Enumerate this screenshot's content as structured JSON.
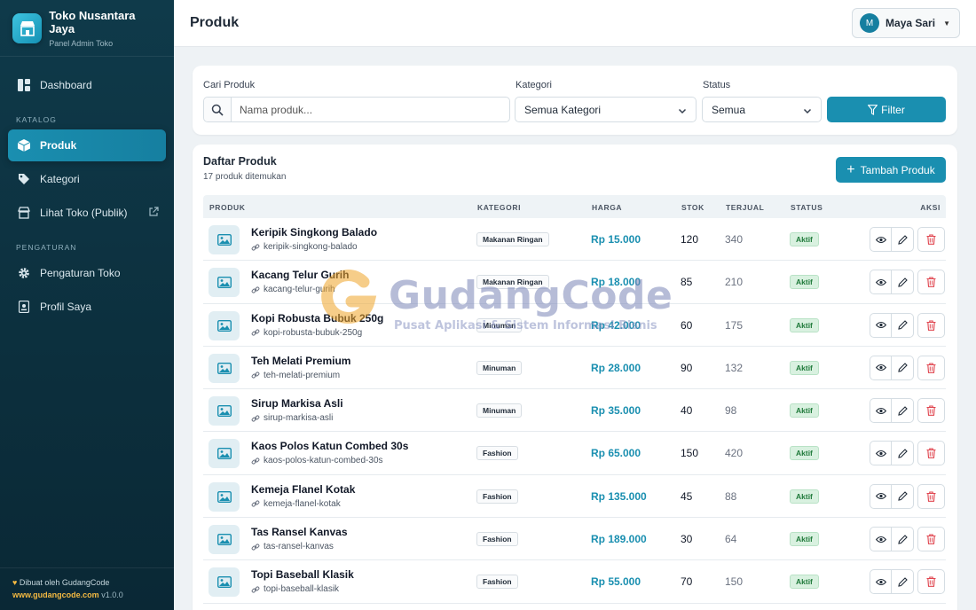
{
  "brand": {
    "name": "Toko Nusantara Jaya",
    "subtitle": "Panel Admin Toko"
  },
  "nav": {
    "dashboard": "Dashboard",
    "section_katalog": "KATALOG",
    "produk": "Produk",
    "kategori": "Kategori",
    "lihat_toko": "Lihat Toko (Publik)",
    "section_pengaturan": "PENGATURAN",
    "pengaturan_toko": "Pengaturan Toko",
    "profil_saya": "Profil Saya"
  },
  "footer": {
    "credit": "Dibuat oleh GudangCode",
    "site": "www.gudangcode.com",
    "version": "v1.0.0"
  },
  "header": {
    "title": "Produk",
    "user_initial": "M",
    "user_name": "Maya Sari"
  },
  "filter": {
    "search_label": "Cari Produk",
    "search_placeholder": "Nama produk...",
    "category_label": "Kategori",
    "category_value": "Semua Kategori",
    "status_label": "Status",
    "status_value": "Semua",
    "button": "Filter"
  },
  "list": {
    "title": "Daftar Produk",
    "count_text": "17 produk ditemukan",
    "add_button": "Tambah Produk",
    "columns": {
      "produk": "PRODUK",
      "kategori": "KATEGORI",
      "harga": "HARGA",
      "stok": "STOK",
      "terjual": "TERJUAL",
      "status": "STATUS",
      "aksi": "AKSI"
    },
    "rows": [
      {
        "name": "Keripik Singkong Balado",
        "slug": "keripik-singkong-balado",
        "category": "Makanan Ringan",
        "price": "Rp 15.000",
        "stock": "120",
        "sold": "340",
        "status": "Aktif"
      },
      {
        "name": "Kacang Telur Gurih",
        "slug": "kacang-telur-gurih",
        "category": "Makanan Ringan",
        "price": "Rp 18.000",
        "stock": "85",
        "sold": "210",
        "status": "Aktif"
      },
      {
        "name": "Kopi Robusta Bubuk 250g",
        "slug": "kopi-robusta-bubuk-250g",
        "category": "Minuman",
        "price": "Rp 42.000",
        "stock": "60",
        "sold": "175",
        "status": "Aktif"
      },
      {
        "name": "Teh Melati Premium",
        "slug": "teh-melati-premium",
        "category": "Minuman",
        "price": "Rp 28.000",
        "stock": "90",
        "sold": "132",
        "status": "Aktif"
      },
      {
        "name": "Sirup Markisa Asli",
        "slug": "sirup-markisa-asli",
        "category": "Minuman",
        "price": "Rp 35.000",
        "stock": "40",
        "sold": "98",
        "status": "Aktif"
      },
      {
        "name": "Kaos Polos Katun Combed 30s",
        "slug": "kaos-polos-katun-combed-30s",
        "category": "Fashion",
        "price": "Rp 65.000",
        "stock": "150",
        "sold": "420",
        "status": "Aktif"
      },
      {
        "name": "Kemeja Flanel Kotak",
        "slug": "kemeja-flanel-kotak",
        "category": "Fashion",
        "price": "Rp 135.000",
        "stock": "45",
        "sold": "88",
        "status": "Aktif"
      },
      {
        "name": "Tas Ransel Kanvas",
        "slug": "tas-ransel-kanvas",
        "category": "Fashion",
        "price": "Rp 189.000",
        "stock": "30",
        "sold": "64",
        "status": "Aktif"
      },
      {
        "name": "Topi Baseball Klasik",
        "slug": "topi-baseball-klasik",
        "category": "Fashion",
        "price": "Rp 55.000",
        "stock": "70",
        "sold": "150",
        "status": "Aktif"
      }
    ]
  },
  "watermark": {
    "title": "GudangCode",
    "subtitle": "Pusat Aplikasi & Sistem Informasi Bisnis"
  },
  "colors": {
    "accent": "#1a8fb0",
    "sidebar": "#0f3a4a",
    "status_active": "#d9f1e0",
    "danger": "#e0454f"
  }
}
